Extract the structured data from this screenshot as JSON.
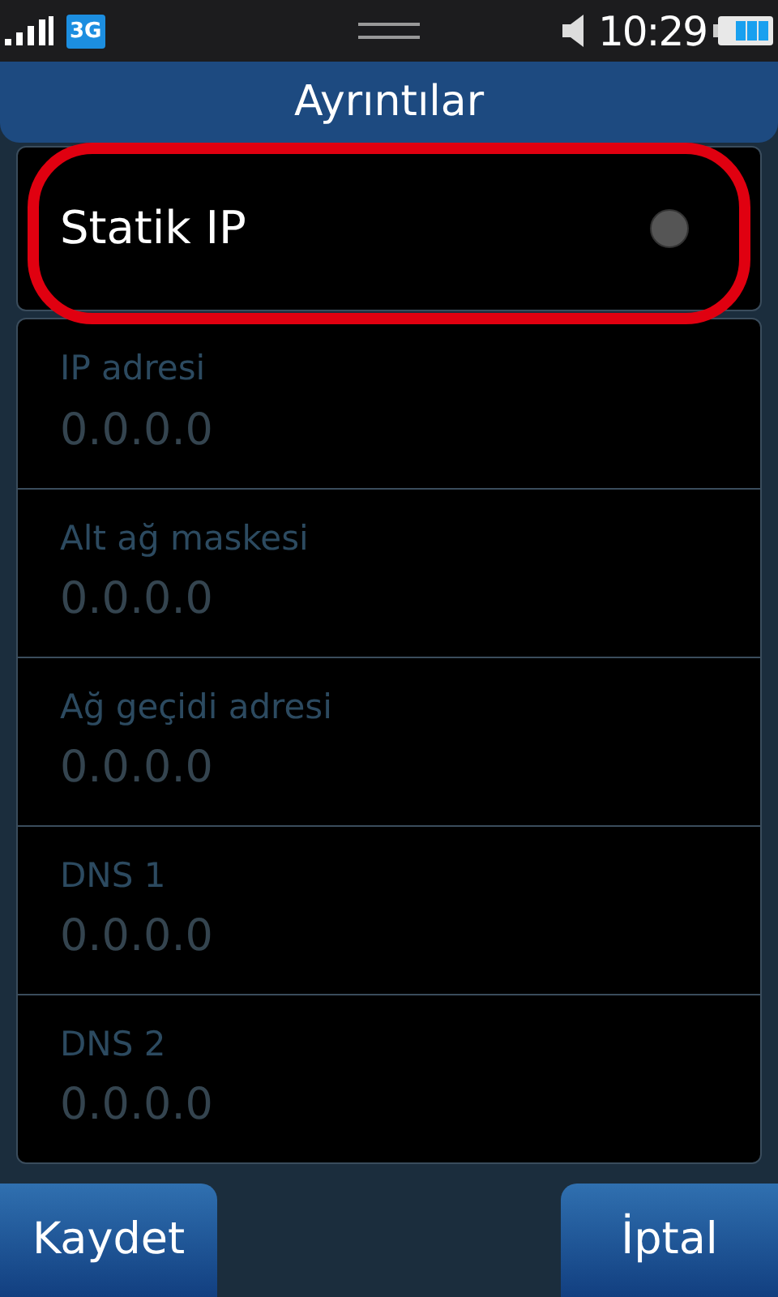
{
  "status_bar": {
    "network": "3G",
    "time": "10:29"
  },
  "title": "Ayrıntılar",
  "static_ip": {
    "label": "Statik IP",
    "on": false,
    "highlighted": true
  },
  "fields": [
    {
      "label": "IP adresi",
      "value": "0.0.0.0",
      "disabled": true
    },
    {
      "label": "Alt ağ maskesi",
      "value": "0.0.0.0",
      "disabled": true
    },
    {
      "label": "Ağ geçidi adresi",
      "value": "0.0.0.0",
      "disabled": true
    },
    {
      "label": "DNS 1",
      "value": "0.0.0.0",
      "disabled": true
    },
    {
      "label": "DNS 2",
      "value": "0.0.0.0",
      "disabled": true
    }
  ],
  "buttons": [
    "Kaydet",
    "İptal"
  ]
}
